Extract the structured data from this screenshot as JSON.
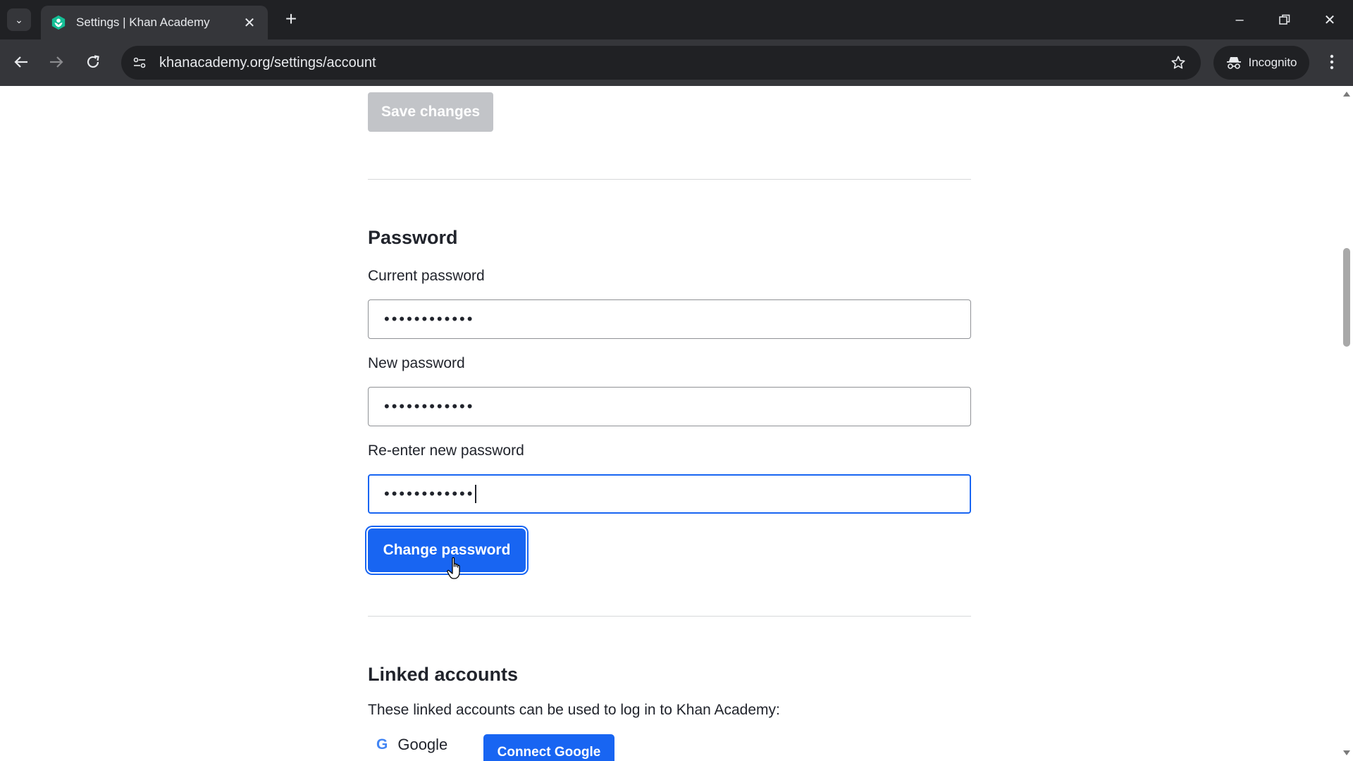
{
  "browser": {
    "tab_title": "Settings | Khan Academy",
    "url": "khanacademy.org/settings/account",
    "incognito_label": "Incognito"
  },
  "page": {
    "save_changes_label": "Save changes",
    "password": {
      "heading": "Password",
      "current_label": "Current password",
      "current_value": "••••••••••••",
      "new_label": "New password",
      "new_value": "••••••••••••",
      "reenter_label": "Re-enter new password",
      "reenter_value": "••••••••••••",
      "change_button": "Change password"
    },
    "linked": {
      "heading": "Linked accounts",
      "description": "These linked accounts can be used to log in to Khan Academy:",
      "google_logo": "G",
      "google_label": "Google",
      "connect_button": "Connect Google"
    }
  },
  "colors": {
    "primary": "#1865f2",
    "disabled": "#c2c4c8",
    "text": "#21242c"
  }
}
